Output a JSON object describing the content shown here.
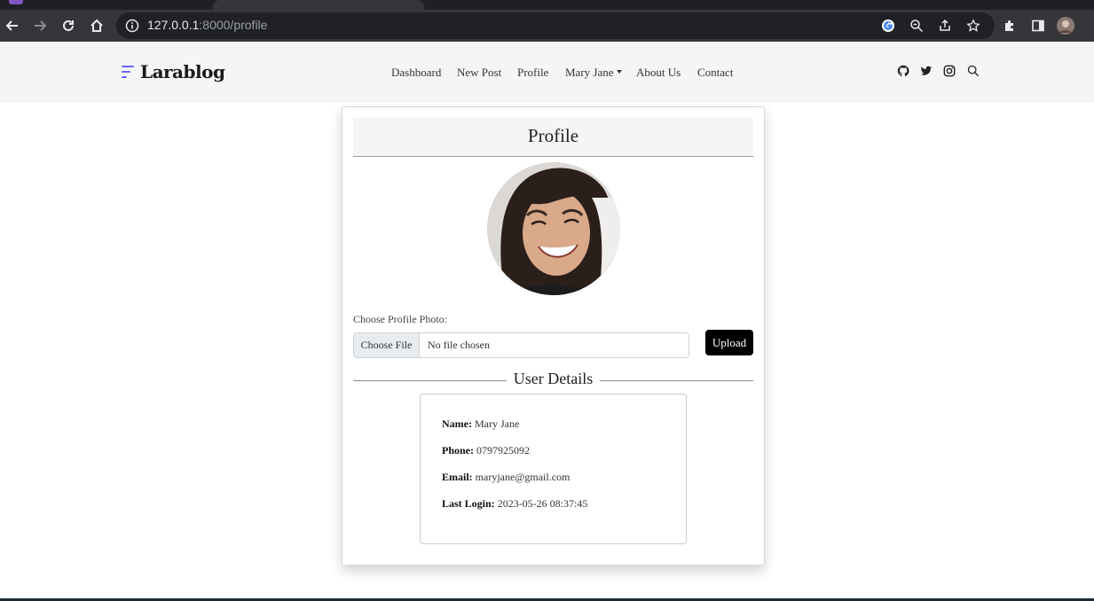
{
  "browser": {
    "url_host": "127.0.0.1",
    "url_path": ":8000/profile",
    "icons": [
      "back-icon",
      "forward-icon",
      "reload-icon",
      "home-icon",
      "info-icon",
      "google-icon",
      "zoom-icon",
      "share-icon",
      "star-icon",
      "extensions-icon",
      "sidepanel-icon",
      "profile-avatar-icon"
    ]
  },
  "site": {
    "brand": "Larablog",
    "nav": {
      "dashboard": "Dashboard",
      "new_post": "New Post",
      "profile": "Profile",
      "user": "Mary Jane",
      "about": "About Us",
      "contact": "Contact"
    },
    "social_icons": [
      "github-icon",
      "twitter-icon",
      "instagram-icon",
      "search-icon"
    ]
  },
  "profile": {
    "title": "Profile",
    "photo_label": "Choose Profile Photo:",
    "choose_file": "Choose File",
    "file_status": "No file chosen",
    "upload": "Upload",
    "section_title": "User Details",
    "details": {
      "name_label": "Name:",
      "name": "Mary Jane",
      "phone_label": "Phone:",
      "phone": "0797925092",
      "email_label": "Email:",
      "email": "maryjane@gmail.com",
      "last_login_label": "Last Login:",
      "last_login": "2023-05-26 08:37:45"
    }
  },
  "colors": {
    "brand_accent": "#6c63ff",
    "chrome_dark": "#35363a",
    "upload_button": "#000000"
  }
}
